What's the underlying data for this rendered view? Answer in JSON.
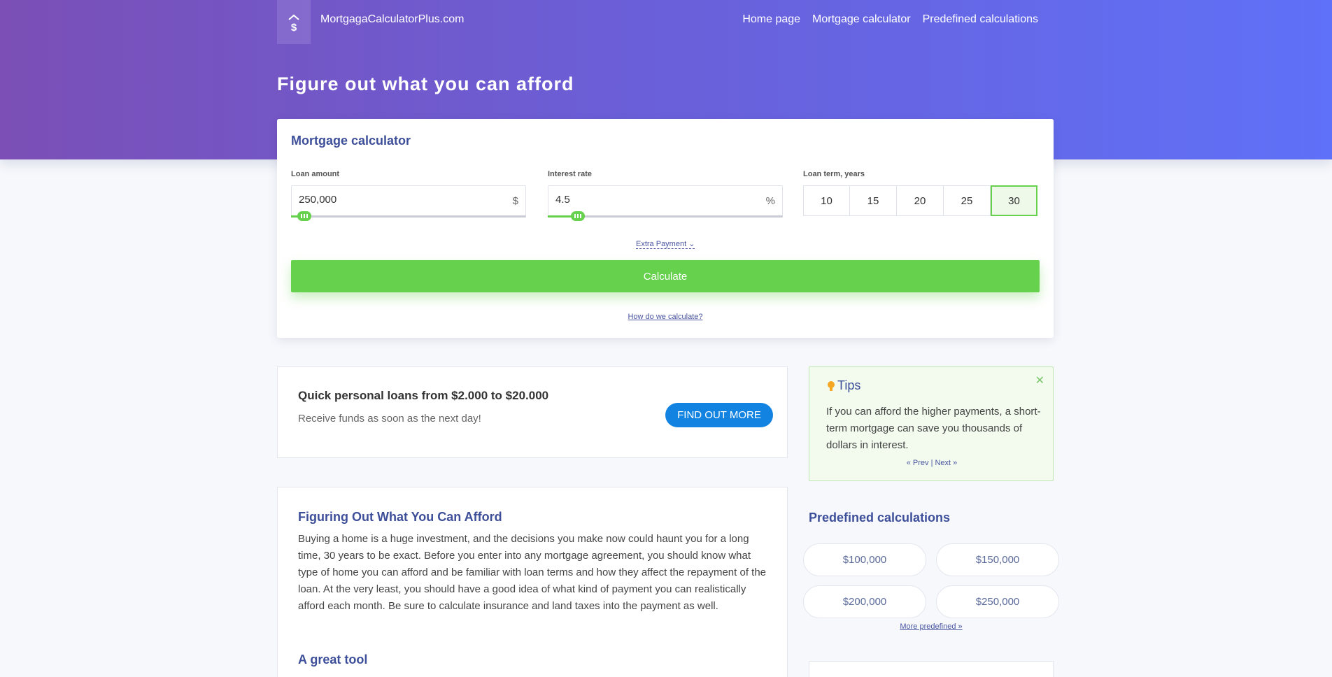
{
  "header": {
    "brand": "MortgagaCalculatorPlus.com",
    "nav": [
      "Home page",
      "Mortgage calculator",
      "Predefined calculations"
    ],
    "title": "Figure out what you can afford"
  },
  "calculator": {
    "title": "Mortgage calculator",
    "loan_amount": {
      "label": "Loan amount",
      "value": "250,000",
      "unit": "$",
      "slider_fraction": 0.04
    },
    "interest_rate": {
      "label": "Interest rate",
      "value": "4.5",
      "unit": "%",
      "slider_fraction": 0.11
    },
    "loan_term": {
      "label": "Loan term, years",
      "options": [
        "10",
        "15",
        "20",
        "25",
        "30"
      ],
      "selected": "30"
    },
    "extra_payment": "Extra Payment",
    "calculate": "Calculate",
    "how": "How do we calculate?"
  },
  "ad": {
    "title": "Quick personal loans from $2.000 to $20.000",
    "subtitle": "Receive funds as soon as the next day!",
    "button": "FIND OUT MORE"
  },
  "tips": {
    "title": "Tips",
    "text": "If you can afford the higher payments, a short-term mortgage can save you thousands of dollars in interest.",
    "prev": "« Prev",
    "separator": "|",
    "next": "Next »"
  },
  "article": {
    "heading": "Figuring Out What You Can Afford",
    "paragraph": "Buying a home is a huge investment, and the decisions you make now could haunt you for a long time, 30 years to be exact. Before you enter into any mortgage agreement, you should know what type of home you can afford and be familiar with loan terms and how they affect the repayment of the loan. At the very least, you should have a good idea of what kind of payment you can realistically afford each month. Be sure to calculate insurance and land taxes into the payment as well.",
    "subheading": "A great tool"
  },
  "predefined": {
    "title": "Predefined calculations",
    "items": [
      "$100,000",
      "$150,000",
      "$200,000",
      "$250,000"
    ],
    "more": "More predefined »"
  },
  "colors": {
    "accent_green": "#66d14c",
    "link_blue": "#1283e0",
    "heading_blue": "#3e4f9a"
  }
}
